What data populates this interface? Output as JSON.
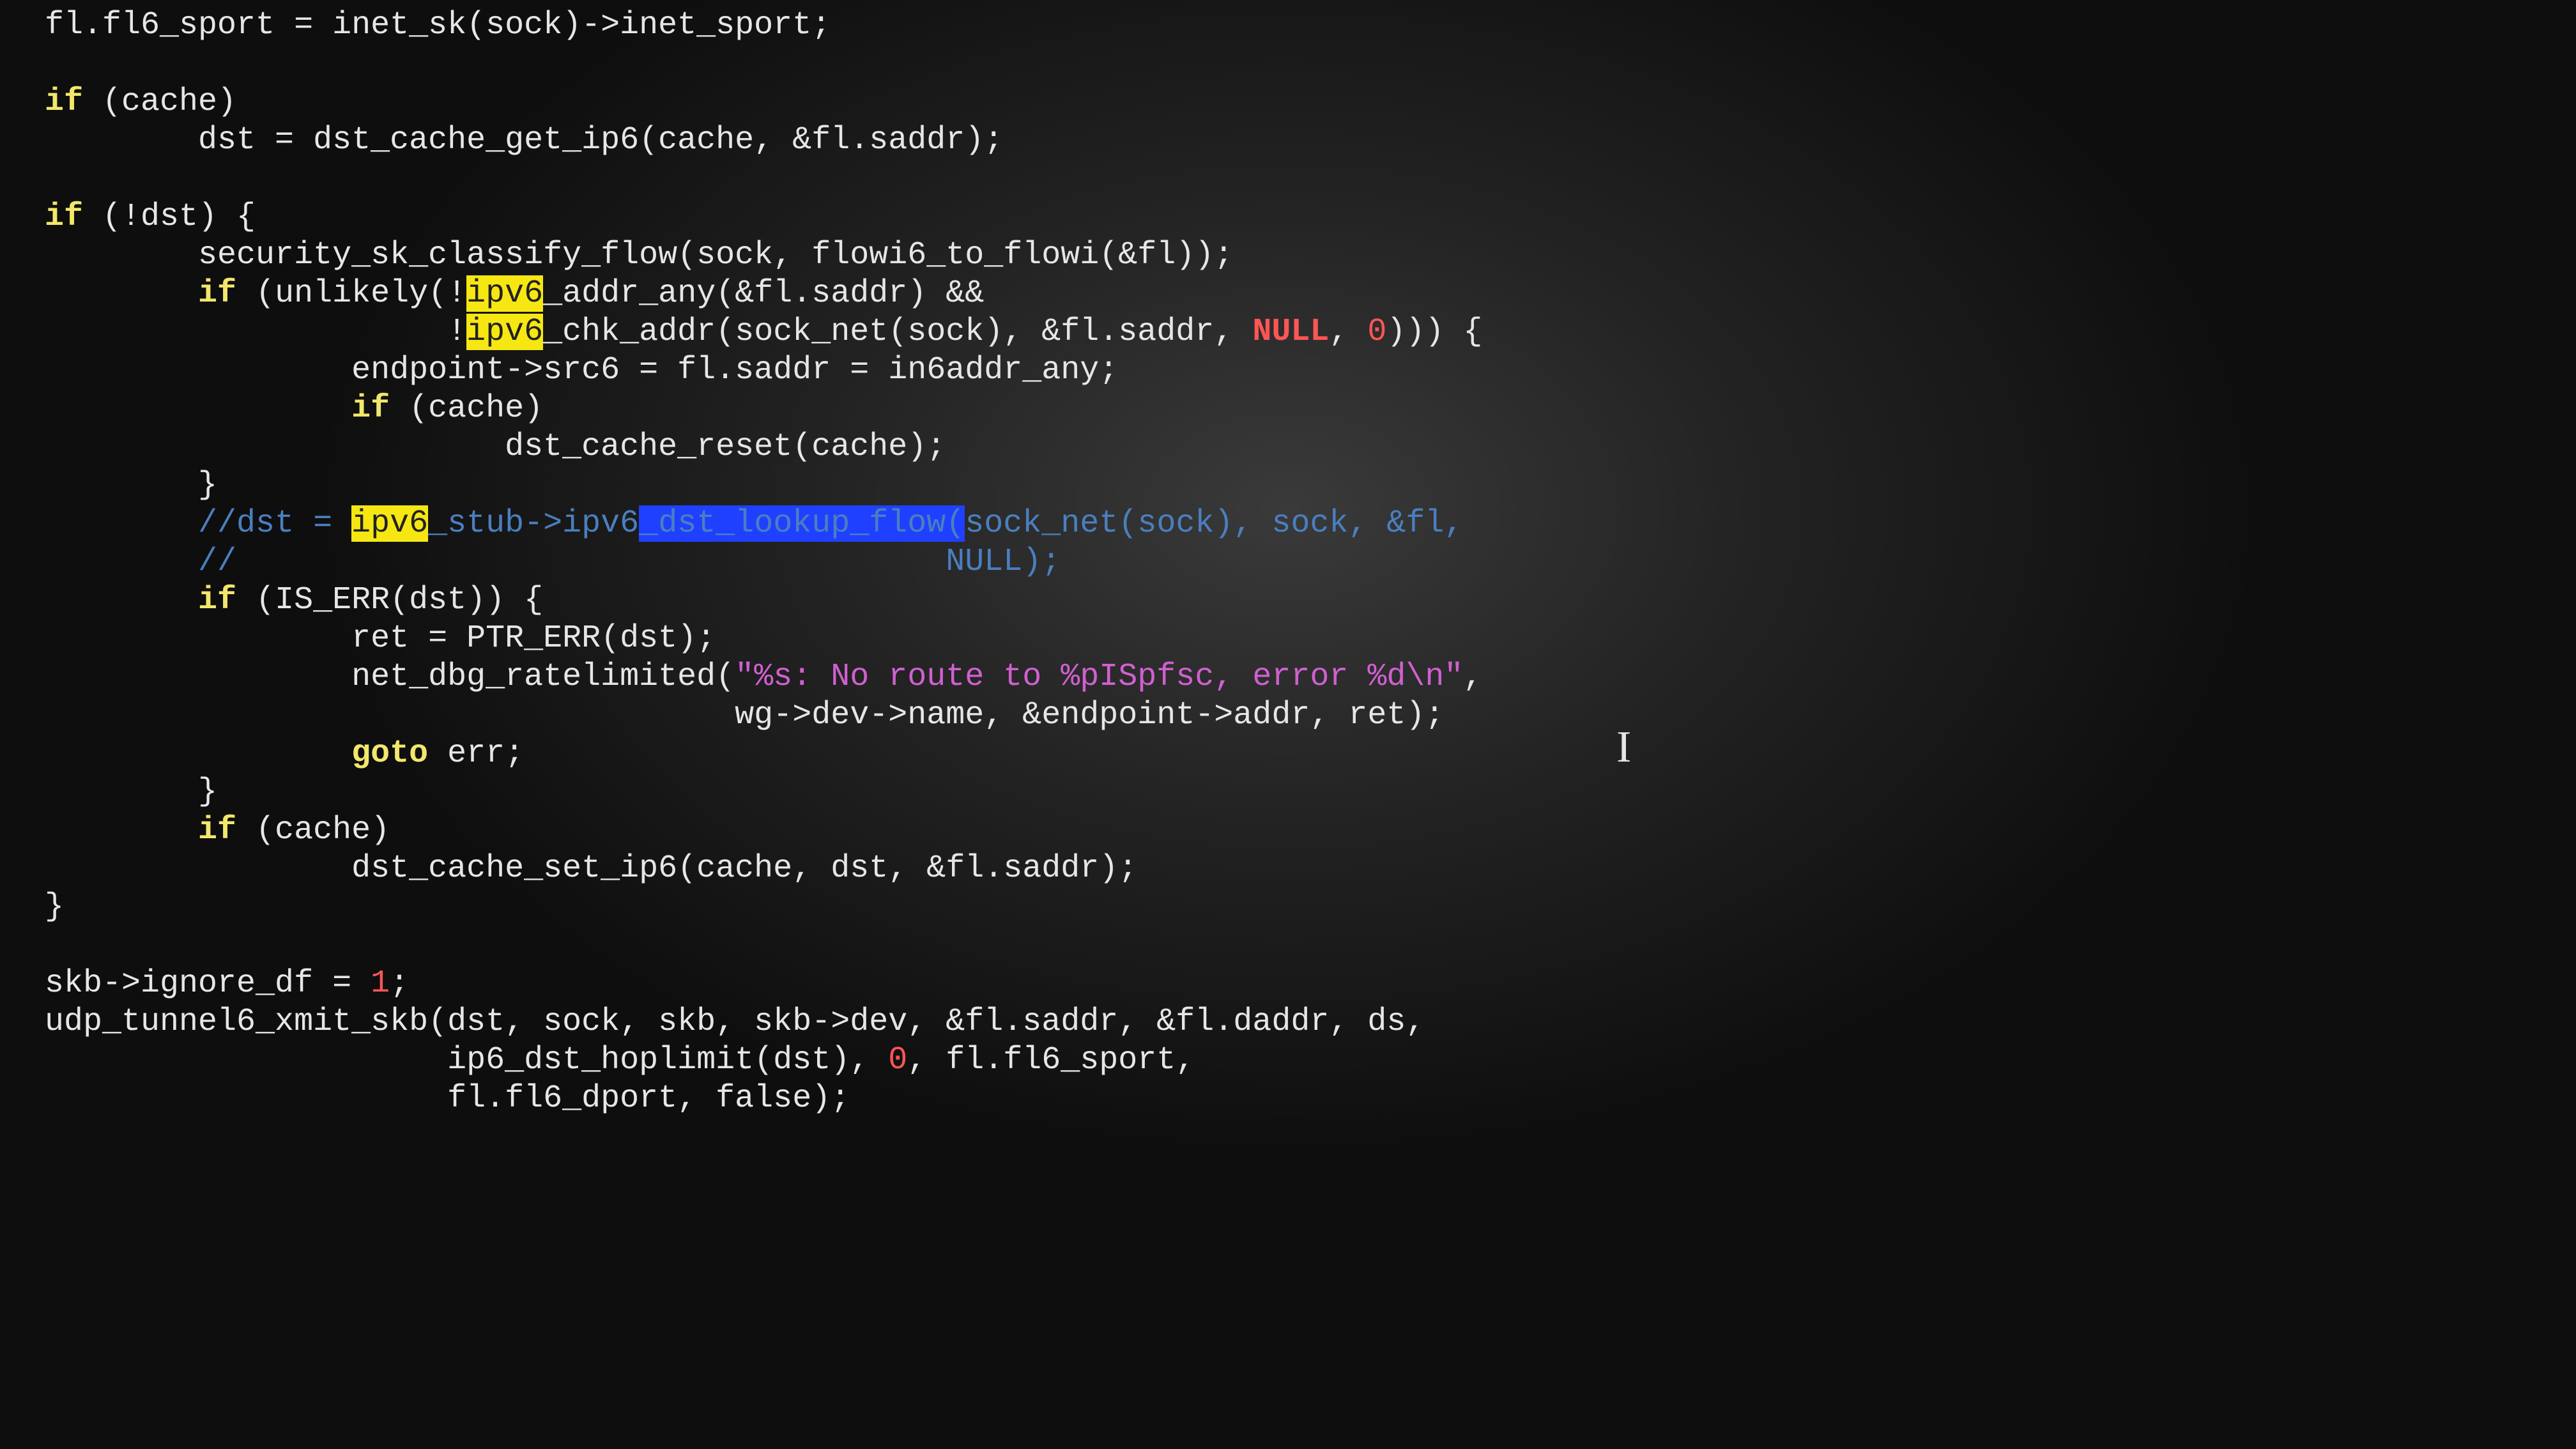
{
  "highlights": {
    "search_match": "ipv6",
    "selection_text": "_dst_lookup_flow("
  },
  "colors": {
    "keyword": "#f2e76b",
    "comment": "#4a7fbf",
    "string": "#d060d0",
    "number": "#ff5555",
    "null": "#ff5555",
    "highlight_bg": "#f6e713",
    "selection_bg": "#2040ff",
    "background": "#1a1a1a",
    "foreground": "#e6e6e6"
  },
  "tokens": {
    "if": "if",
    "goto": "goto",
    "NULL": "NULL",
    "zero": "0",
    "one": "1",
    "ipv6": "ipv6"
  },
  "code_lines": [
    "fl.fl6_sport = inet_sk(sock)->inet_sport;",
    "",
    "if (cache)",
    "        dst = dst_cache_get_ip6(cache, &fl.saddr);",
    "",
    "if (!dst) {",
    "        security_sk_classify_flow(sock, flowi6_to_flowi(&fl));",
    "        if (unlikely(!ipv6_addr_any(&fl.saddr) &&",
    "                     !ipv6_chk_addr(sock_net(sock), &fl.saddr, NULL, 0))) {",
    "                endpoint->src6 = fl.saddr = in6addr_any;",
    "                if (cache)",
    "                        dst_cache_reset(cache);",
    "        }",
    "        //dst = ipv6_stub->ipv6_dst_lookup_flow(sock_net(sock), sock, &fl,",
    "        //                                     NULL);",
    "        if (IS_ERR(dst)) {",
    "                ret = PTR_ERR(dst);",
    "                net_dbg_ratelimited(\"%s: No route to %pISpfsc, error %d\\n\",",
    "                                    wg->dev->name, &endpoint->addr, ret);",
    "                goto err;",
    "        }",
    "        if (cache)",
    "                dst_cache_set_ip6(cache, dst, &fl.saddr);",
    "}",
    "",
    "skb->ignore_df = 1;",
    "udp_tunnel6_xmit_skb(dst, sock, skb, skb->dev, &fl.saddr, &fl.daddr, ds,",
    "                     ip6_dst_hoplimit(dst), 0, fl.fl6_sport,",
    "                     fl.fl6_dport, false);"
  ],
  "cursor": {
    "line": 14,
    "col": 66
  },
  "string_literal": "\"%s: No route to %pISpfsc, error %d\\n\""
}
